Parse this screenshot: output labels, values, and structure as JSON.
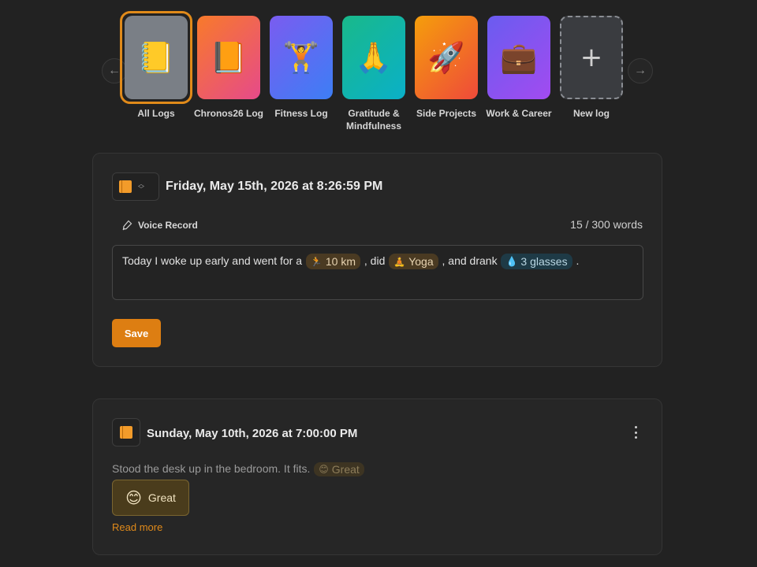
{
  "carousel": {
    "prev_arrow": "←",
    "next_arrow": "→",
    "logs": [
      {
        "label": "All Logs",
        "emoji": "📒",
        "selected": true,
        "bg": "#7a7f86"
      },
      {
        "label": "Chronos26 Log",
        "emoji": "📙",
        "bg": "linear-gradient(135deg,#f87a2a,#e64a8a)"
      },
      {
        "label": "Fitness Log",
        "emoji": "🏋",
        "bg": "linear-gradient(135deg,#7a5cf0,#3d7ef5)"
      },
      {
        "label": "Gratitude & Mindfulness",
        "emoji": "🙏",
        "bg": "linear-gradient(135deg,#19b98a,#0ab0c8)"
      },
      {
        "label": "Side Projects",
        "emoji": "🚀",
        "bg": "linear-gradient(135deg,#f59e0b,#ef4a3a)"
      },
      {
        "label": "Work & Career",
        "emoji": "💼",
        "bg": "linear-gradient(135deg,#6a5cf0,#a24bf0)"
      },
      {
        "label": "New log",
        "emoji": "+",
        "new": true
      }
    ]
  },
  "entry_form": {
    "date": "Friday, May 15th, 2026 at 8:26:59 PM",
    "voice_record": "Voice Record",
    "word_count": "15 / 300 words",
    "text_parts": {
      "p1": "Today I woke up early and went for a",
      "chip1_icon": "🏃",
      "chip1": "10 km",
      "p2": ", did",
      "chip2_icon": "🧘",
      "chip2": "Yoga",
      "p3": ", and drank",
      "chip3_icon": "💧",
      "chip3": "3 glasses",
      "p4": "."
    },
    "save_label": "Save"
  },
  "entry": {
    "date": "Sunday, May 10th, 2026 at 7:00:00 PM",
    "text": "Stood the desk up in the bedroom. It fits.",
    "inline_mood_icon": "😊",
    "inline_mood": "Great",
    "mood_icon": "😊",
    "mood_label": "Great",
    "read_more": "Read more"
  },
  "colors": {
    "accent": "#dd7e12",
    "background": "#222222",
    "card": "#262626"
  }
}
